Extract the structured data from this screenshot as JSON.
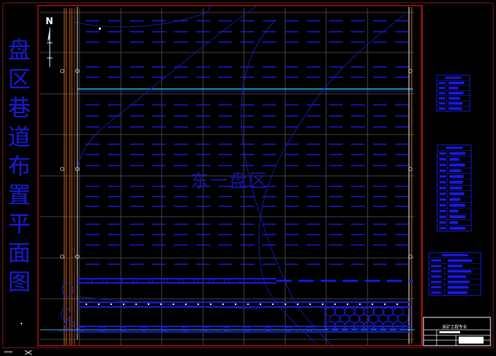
{
  "drawing": {
    "title_chars": [
      "盘",
      "区",
      "巷",
      "道",
      "布",
      "置",
      "平",
      "面",
      "图"
    ],
    "area_label": "东一盘区",
    "north_label": "N",
    "title_block_text": "采矿工程专业"
  },
  "colors": {
    "background": "#000000",
    "frame_red": "#b01818",
    "grid_white": "#c8c8c8",
    "roadway_blue": "#1a1ae6",
    "contour_blue": "#1a1ab4",
    "roadway_orange": "#e0701a",
    "cyan_line": "#28c8c8",
    "title_blue": "#1a1ad8"
  },
  "icons": {
    "north_arrow": "north-arrow-icon",
    "compass": "compass-icon"
  }
}
